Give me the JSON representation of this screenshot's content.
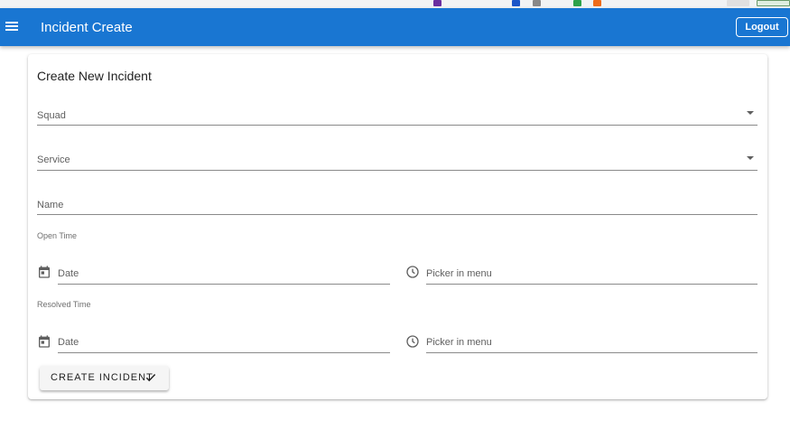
{
  "app": {
    "title": "Incident Create",
    "logout_label": "Logout"
  },
  "form": {
    "title": "Create New Incident",
    "squad": {
      "label": "Squad",
      "value": ""
    },
    "service": {
      "label": "Service",
      "value": ""
    },
    "name": {
      "label": "Name",
      "value": ""
    },
    "open_time": {
      "label": "Open Time",
      "date_label": "Date",
      "time_label": "Picker in menu"
    },
    "resolved_time": {
      "label": "Resolved Time",
      "date_label": "Date",
      "time_label": "Picker in menu"
    },
    "submit_label": "CREATE INCIDENT"
  },
  "colors": {
    "appbar": "#1976d2",
    "button_bg": "#f5f5f5"
  },
  "icons": [
    "menu-icon",
    "dropdown-arrow-icon",
    "calendar-icon",
    "clock-icon",
    "check-icon"
  ]
}
